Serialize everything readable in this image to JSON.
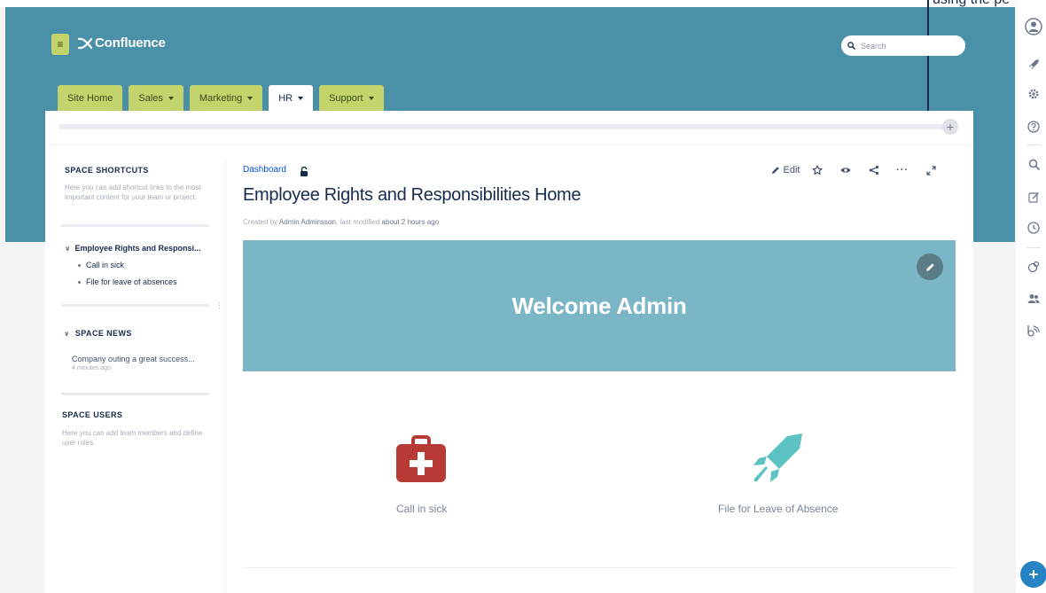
{
  "callout": {
    "text": "using the pe"
  },
  "header": {
    "app_name": "Confluence",
    "search": {
      "placeholder": "Search"
    }
  },
  "tabs": [
    {
      "label": "Site Home",
      "dropdown": false
    },
    {
      "label": "Sales",
      "dropdown": true
    },
    {
      "label": "Marketing",
      "dropdown": true
    },
    {
      "label": "HR",
      "dropdown": true,
      "active": true
    },
    {
      "label": "Support",
      "dropdown": true
    }
  ],
  "sidebar": {
    "shortcuts": {
      "heading": "SPACE SHORTCUTS",
      "text": "Here you can add shortcut links to the most important content for your team or project."
    },
    "tree": {
      "title": "Employee Rights and Responsi...",
      "items": [
        "Call in sick",
        "File for leave of absences"
      ]
    },
    "news": {
      "heading": "SPACE NEWS",
      "item": "Company outing a great success...",
      "time": "4 minutes ago"
    },
    "users": {
      "heading": "SPACE USERS",
      "text": "Here you can add team members and define user roles."
    }
  },
  "page": {
    "breadcrumb": "Dashboard",
    "actions": {
      "edit_label": "Edit"
    },
    "title": "Employee Rights and Responsibilities Home",
    "byline": {
      "created_prefix": "Created by",
      "author": "Admin Adminsson",
      "modified_prefix": ", last modified",
      "modified": "about 2 hours ago"
    },
    "banner": {
      "title": "Welcome Admin",
      "color": "#7ab6c6"
    },
    "tiles": [
      {
        "label": "Call in sick",
        "icon": "first-aid-kit-icon",
        "color": "#b83a35"
      },
      {
        "label": "File for Leave of Absence",
        "icon": "rocket-icon",
        "color": "#5cc2c4"
      }
    ]
  },
  "colors": {
    "header_band": "#4a90a8",
    "tab": "#c2d46b",
    "link": "#0052cc",
    "fab": "#2684c4"
  }
}
